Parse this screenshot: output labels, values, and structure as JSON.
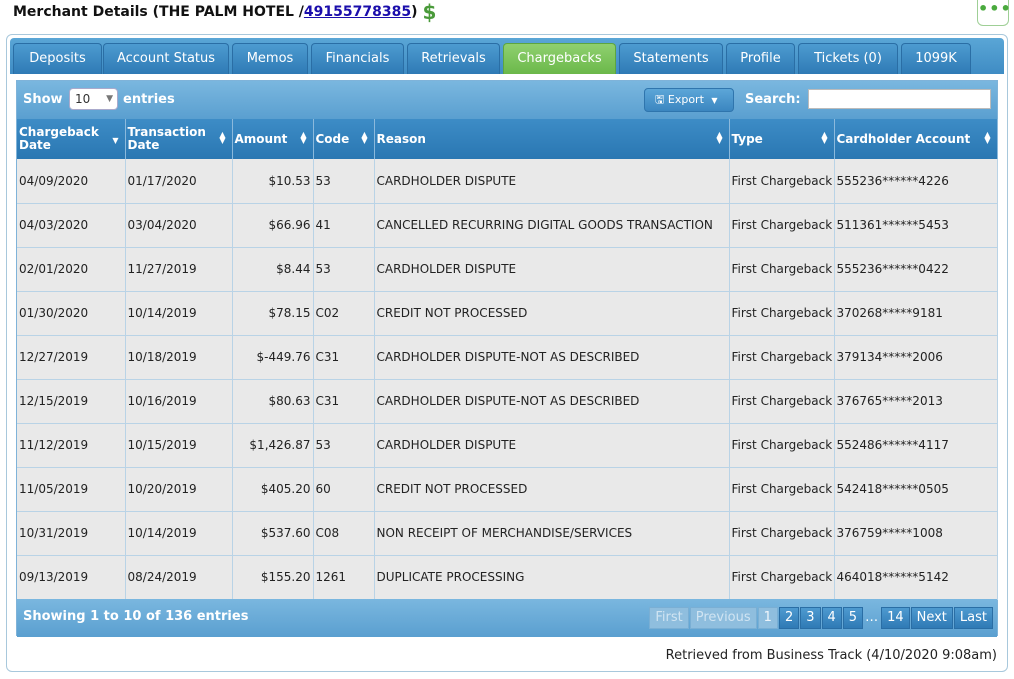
{
  "header": {
    "title_prefix": "Merchant Details (THE PALM HOTEL / ",
    "merchant_id": "49155778385",
    "title_suffix": ")",
    "dollar_icon": "$",
    "menu_dots": "•••"
  },
  "tabs": [
    {
      "label": "Deposits"
    },
    {
      "label": "Account Status"
    },
    {
      "label": "Memos"
    },
    {
      "label": "Financials"
    },
    {
      "label": "Retrievals"
    },
    {
      "label": "Chargebacks",
      "active": true
    },
    {
      "label": "Statements"
    },
    {
      "label": "Profile"
    },
    {
      "label": "Tickets (0)"
    },
    {
      "label": "1099K"
    }
  ],
  "toolbar": {
    "show_label": "Show",
    "length_value": "10",
    "entries_label": "entries",
    "export_label": "Export",
    "search_label": "Search:",
    "search_value": ""
  },
  "columns": [
    "Chargeback Date",
    "Transaction Date",
    "Amount",
    "Code",
    "Reason",
    "Type",
    "Cardholder Account"
  ],
  "rows": [
    [
      "04/09/2020",
      "01/17/2020",
      "$10.53",
      "53",
      "CARDHOLDER DISPUTE",
      "First Chargeback",
      "555236******4226"
    ],
    [
      "04/03/2020",
      "03/04/2020",
      "$66.96",
      "41",
      "CANCELLED RECURRING DIGITAL GOODS TRANSACTION",
      "First Chargeback",
      "511361******5453"
    ],
    [
      "02/01/2020",
      "11/27/2019",
      "$8.44",
      "53",
      "CARDHOLDER DISPUTE",
      "First Chargeback",
      "555236******0422"
    ],
    [
      "01/30/2020",
      "10/14/2019",
      "$78.15",
      "C02",
      "CREDIT NOT PROCESSED",
      "First Chargeback",
      "370268*****9181"
    ],
    [
      "12/27/2019",
      "10/18/2019",
      "$-449.76",
      "C31",
      "CARDHOLDER DISPUTE-NOT AS DESCRIBED",
      "First Chargeback",
      "379134*****2006"
    ],
    [
      "12/15/2019",
      "10/16/2019",
      "$80.63",
      "C31",
      "CARDHOLDER DISPUTE-NOT AS DESCRIBED",
      "First Chargeback",
      "376765*****2013"
    ],
    [
      "11/12/2019",
      "10/15/2019",
      "$1,426.87",
      "53",
      "CARDHOLDER DISPUTE",
      "First Chargeback",
      "552486******4117"
    ],
    [
      "11/05/2019",
      "10/20/2019",
      "$405.20",
      "60",
      "CREDIT NOT PROCESSED",
      "First Chargeback",
      "542418******0505"
    ],
    [
      "10/31/2019",
      "10/14/2019",
      "$537.60",
      "C08",
      "NON RECEIPT OF MERCHANDISE/SERVICES",
      "First Chargeback",
      "376759*****1008"
    ],
    [
      "09/13/2019",
      "08/24/2019",
      "$155.20",
      "1261",
      "DUPLICATE PROCESSING",
      "First Chargeback",
      "464018******5142"
    ]
  ],
  "footer": {
    "info": "Showing 1 to 10 of 136 entries",
    "first": "First",
    "previous": "Previous",
    "pages": [
      "1",
      "2",
      "3",
      "4",
      "5"
    ],
    "current_page": "1",
    "ellipsis": "…",
    "last_page": "14",
    "next": "Next",
    "last": "Last"
  },
  "retrieved": "Retrieved from Business Track (4/10/2020 9:08am)",
  "colors": {
    "tab_blue": "#3f8cc4",
    "tab_active": "#6bb84a",
    "header_blue": "#2a77b2",
    "dollar_green": "#4a9a3a"
  }
}
